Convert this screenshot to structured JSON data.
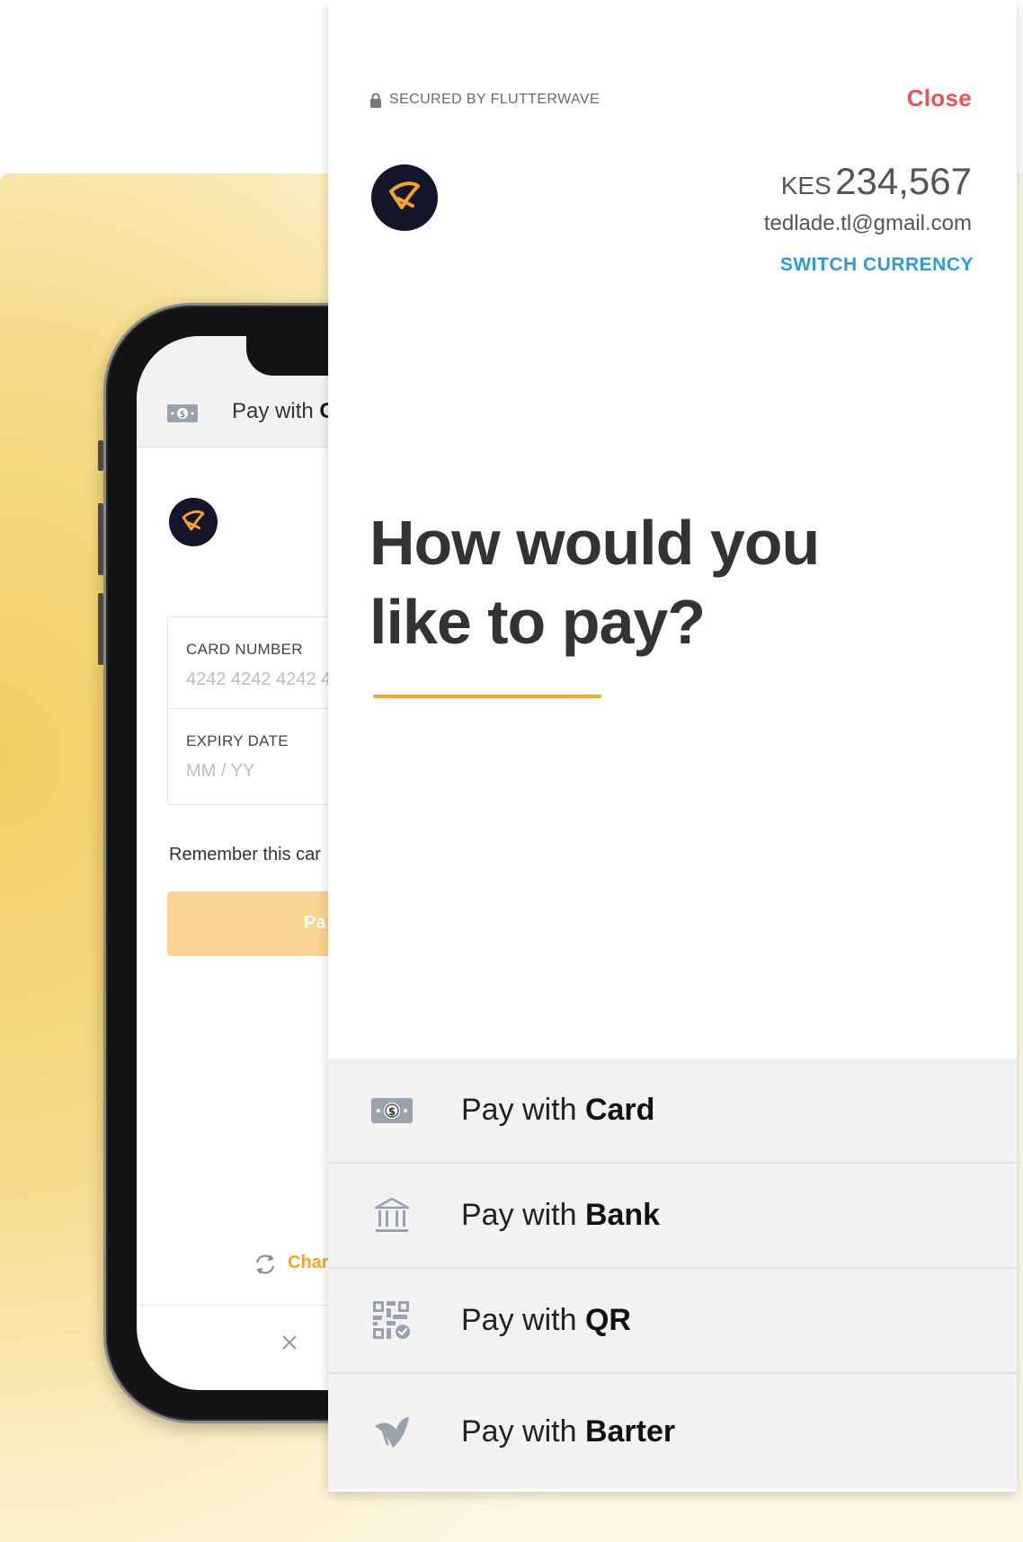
{
  "colors": {
    "accent": "#f5a623",
    "close_red": "#ee5350",
    "link_blue": "#2d9bdb",
    "logo_bg": "#14142b"
  },
  "phone": {
    "header": {
      "prefix": "Pay with",
      "method": "C",
      "icon": "card-cash-icon"
    },
    "card_number_label": "CARD NUMBER",
    "card_number_placeholder": "4242 4242 4242 4",
    "expiry_label": "EXPIRY DATE",
    "expiry_placeholder": "MM / YY",
    "remember_text": "Remember this car",
    "pay_button_text": "Pa",
    "change_text": "Char",
    "icons": {
      "change": "refresh-icon",
      "close": "close-icon"
    }
  },
  "modal": {
    "secured_text": "SECURED BY FLUTTERWAVE",
    "close_label": "Close",
    "currency": "KES",
    "amount": "234,567",
    "email": "tedlade.tl@gmail.com",
    "switch_currency_label": "SWITCH CURRENCY",
    "heading": "How would you like to pay?",
    "methods": [
      {
        "prefix": "Pay with",
        "name": "Card",
        "icon": "card-cash-icon"
      },
      {
        "prefix": "Pay with",
        "name": "Bank",
        "icon": "bank-icon"
      },
      {
        "prefix": "Pay with",
        "name": "QR",
        "icon": "qr-code-icon"
      },
      {
        "prefix": "Pay with",
        "name": "Barter",
        "icon": "barter-icon"
      }
    ]
  }
}
